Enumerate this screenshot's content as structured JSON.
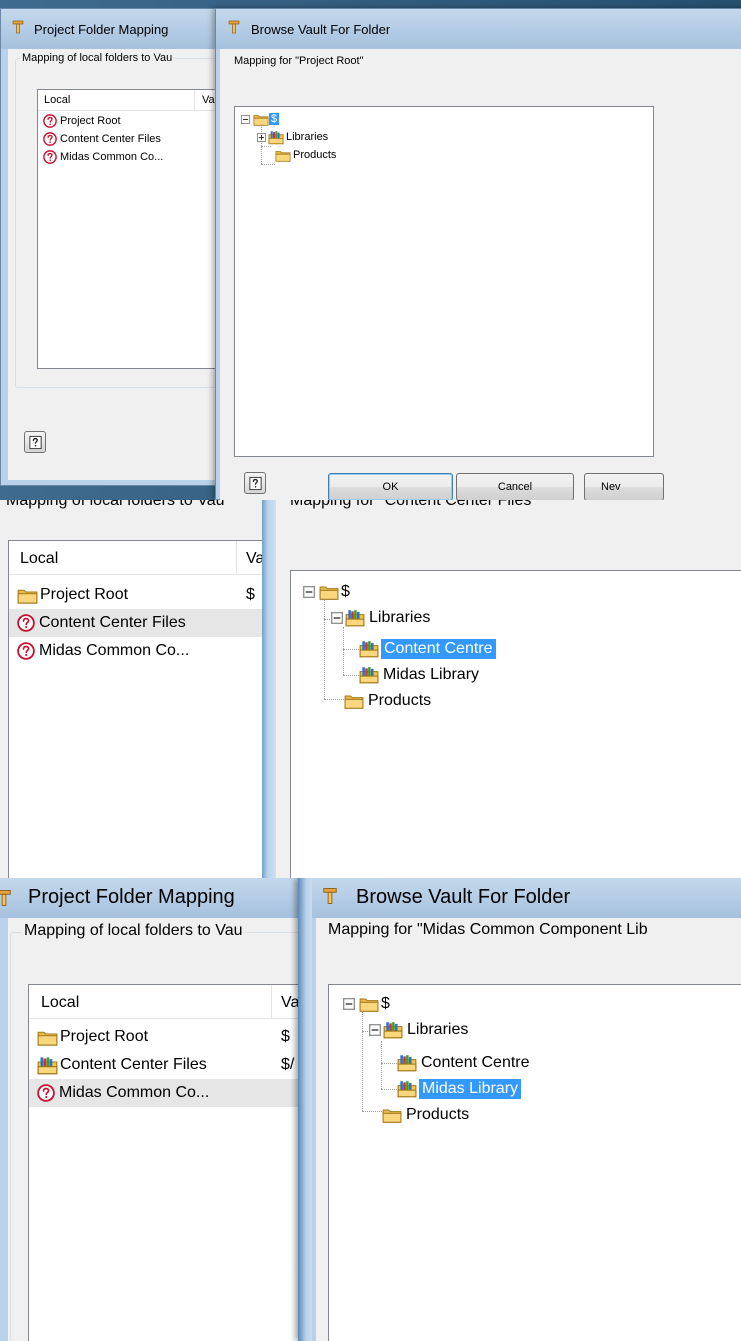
{
  "panel1": {
    "left_window": {
      "title": "Project Folder Mapping",
      "group_label": "Mapping of local folders to Vau",
      "columns": [
        "Local",
        "Va"
      ],
      "rows": [
        {
          "label": "Project Root",
          "icon": "question-icon",
          "value": ""
        },
        {
          "label": "Content Center Files",
          "icon": "question-icon",
          "value": ""
        },
        {
          "label": "Midas Common Co...",
          "icon": "question-icon",
          "value": ""
        }
      ],
      "help_icon": "help-icon"
    },
    "right_window": {
      "title": "Browse Vault For Folder",
      "mapping_label": "Mapping for \"Project Root\"",
      "tree": {
        "root": "$",
        "libraries": "Libraries",
        "products": "Products"
      },
      "buttons": {
        "ok": "OK",
        "cancel": "Cancel",
        "new": "Nev"
      },
      "help_icon": "help-icon"
    }
  },
  "panel2": {
    "left_window": {
      "group_label": "Mapping of local folders to Vau",
      "columns": [
        "Local",
        "Va"
      ],
      "rows": [
        {
          "label": "Project Root",
          "icon": "folder-icon",
          "value": "$"
        },
        {
          "label": "Content Center Files",
          "icon": "question-icon",
          "value": ""
        },
        {
          "label": "Midas Common Co...",
          "icon": "question-icon",
          "value": ""
        }
      ]
    },
    "right_window": {
      "mapping_label": "Mapping for \"Content Center Files\"",
      "tree": {
        "root": "$",
        "libraries": "Libraries",
        "content_centre": "Content Centre",
        "midas_library": "Midas Library",
        "products": "Products"
      }
    }
  },
  "panel3": {
    "left_window": {
      "title": "Project Folder Mapping",
      "group_label": "Mapping of local folders to Vau",
      "columns": [
        "Local",
        "Va"
      ],
      "rows": [
        {
          "label": "Project Root",
          "icon": "folder-icon",
          "value": "$"
        },
        {
          "label": "Content Center Files",
          "icon": "library-folder-icon",
          "value": "$/"
        },
        {
          "label": "Midas Common Co...",
          "icon": "question-icon",
          "value": ""
        }
      ]
    },
    "right_window": {
      "title": "Browse Vault For Folder",
      "mapping_label": "Mapping for \"Midas Common Component Lib",
      "tree": {
        "root": "$",
        "libraries": "Libraries",
        "content_centre": "Content Centre",
        "midas_library": "Midas Library",
        "products": "Products"
      }
    }
  },
  "colors": {
    "selection": "#3399ff",
    "titlebar": "#a9c4e0",
    "window_bg": "#f0f0f0",
    "row_highlight": "#e6e6e6"
  }
}
